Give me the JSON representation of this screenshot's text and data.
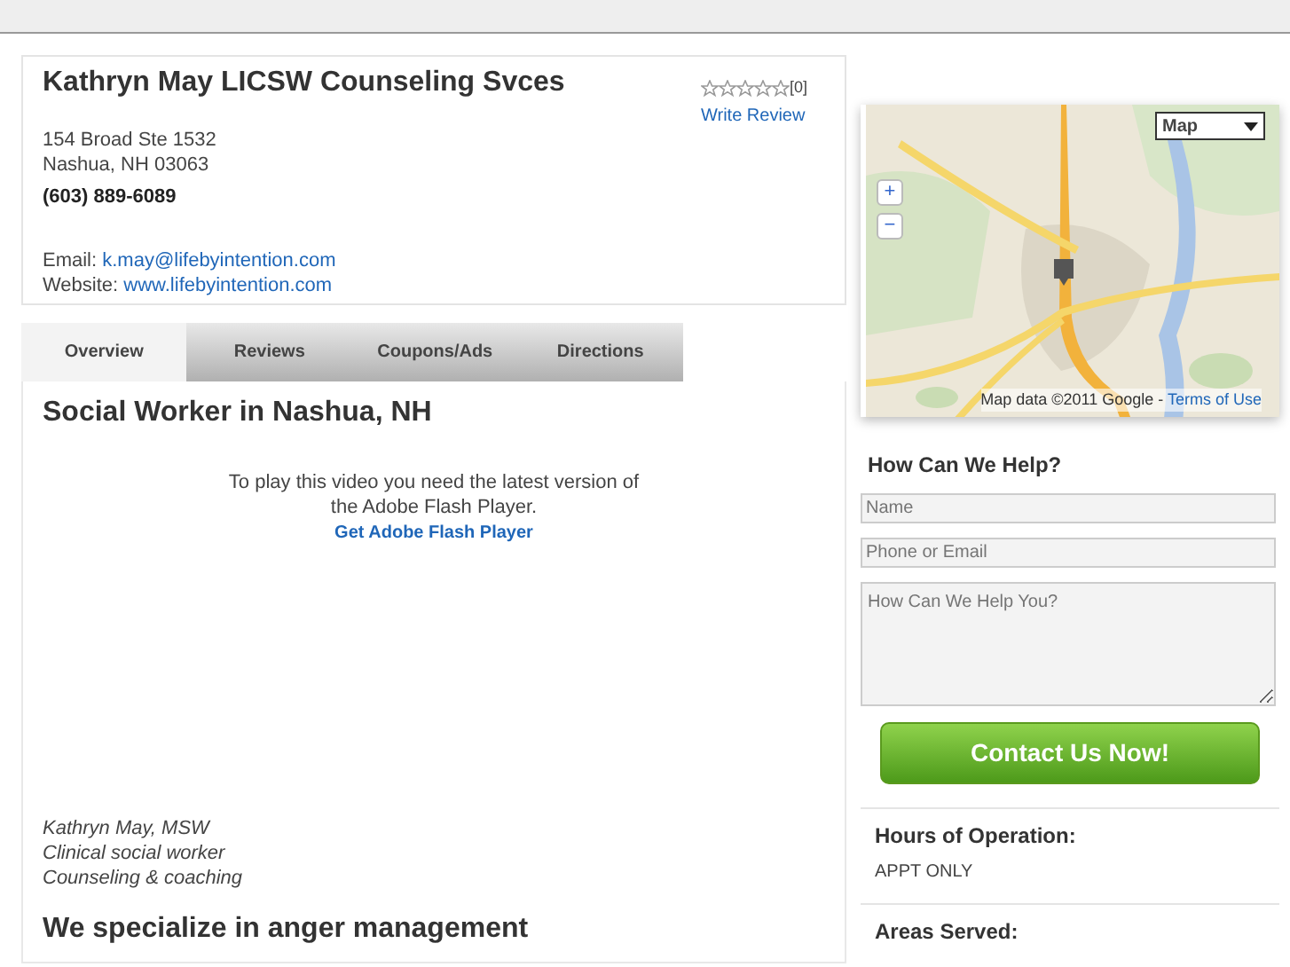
{
  "business": {
    "name": "Kathryn May LICSW Counseling Svces",
    "address_line_1": "154 Broad Ste 1532",
    "address_line_2": "Nashua, NH 03063",
    "phone": "(603) 889-6089",
    "email_label": "Email:",
    "email": "k.may@lifebyintention.com",
    "website_label": "Website:",
    "website": "www.lifebyintention.com",
    "stars": 0,
    "review_count": "[0]",
    "write_review": "Write Review"
  },
  "tabs": [
    {
      "label": "Overview",
      "selected": true
    },
    {
      "label": "Reviews",
      "selected": false
    },
    {
      "label": "Coupons/Ads",
      "selected": false
    },
    {
      "label": "Directions",
      "selected": false
    }
  ],
  "overview": {
    "heading": "Social Worker in Nashua, NH",
    "flash_message": "To play this video you need the latest version of the Adobe Flash Player.",
    "flash_link": "Get Adobe Flash Player",
    "signature": [
      "Kathryn May, MSW",
      "Clinical social worker",
      "Counseling & coaching"
    ],
    "subheading": "We specialize in anger management"
  },
  "map": {
    "kind": "picture",
    "type_select": "Map",
    "zoom_in": "+",
    "zoom_out": "−",
    "attribution": "Map data ©2011 Google - ",
    "terms": "Terms of Use"
  },
  "contact_form": {
    "title": "How Can We Help?",
    "fields": [
      {
        "placeholder": "Name"
      },
      {
        "placeholder": "Phone or Email"
      }
    ],
    "message_placeholder": "How Can We Help You?",
    "submit": "Contact Us Now!"
  },
  "hours": {
    "title": "Hours of Operation:",
    "value": "APPT ONLY"
  },
  "areas": {
    "title": "Areas Served:"
  }
}
